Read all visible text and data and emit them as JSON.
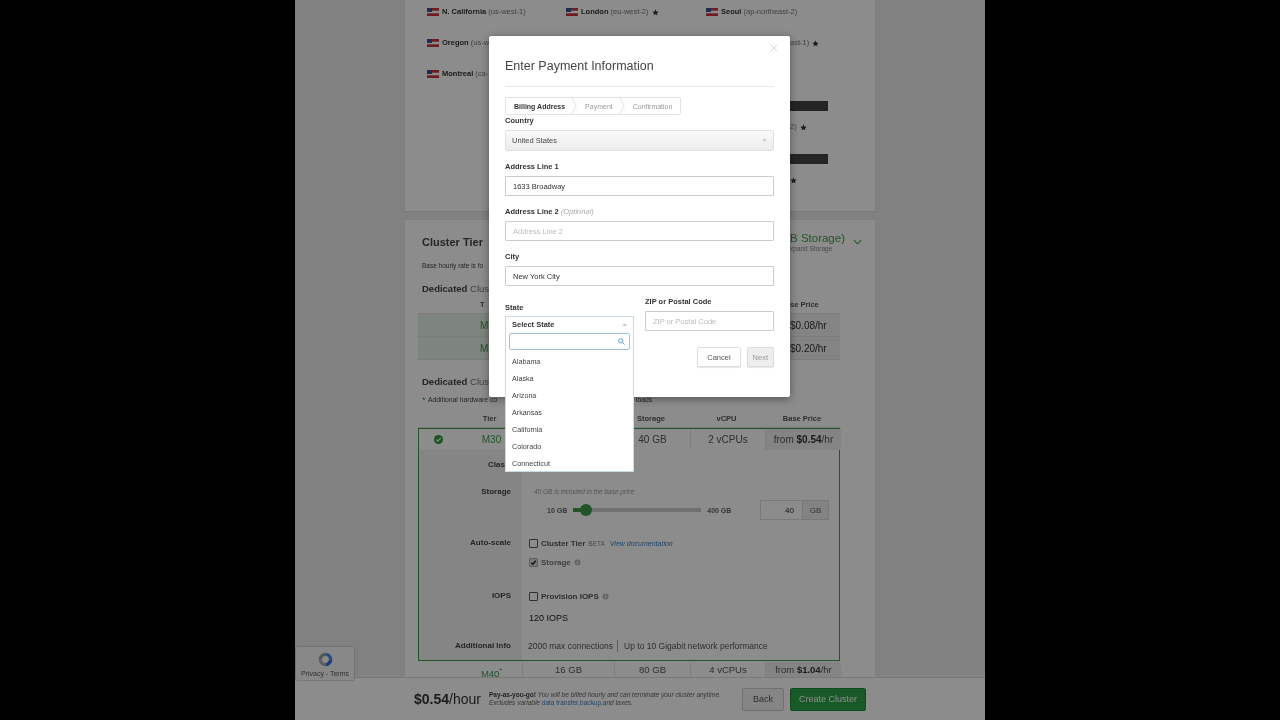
{
  "regions": [
    [
      {
        "kind": "region",
        "name": "N. California",
        "code": "(us-west-1)",
        "star": false
      },
      {
        "kind": "region",
        "name": "Oregon",
        "code": "(us-w",
        "star": false
      },
      {
        "kind": "region",
        "name": "Montreal",
        "code": "(ca-",
        "star": false
      }
    ],
    [
      {
        "kind": "region",
        "name": "London",
        "code": "(eu-west-2)",
        "star": true
      }
    ],
    [
      {
        "kind": "region",
        "name": "Seoul",
        "code": "(ap-northeast-2)",
        "star": false
      },
      {
        "kind": "clipped",
        "code": "ast-1)",
        "star": true
      },
      {
        "kind": "bar"
      },
      {
        "kind": "clipped",
        "code": "2)",
        "star": true
      },
      {
        "kind": "bar"
      },
      {
        "kind": "clipped",
        "star": true
      }
    ]
  ],
  "cluster_tier": {
    "title": "Cluster Tier",
    "summary": "B Storage)",
    "summary_note": "xpand Storage",
    "rate_note": "Base hourly rate is fo",
    "top_group": {
      "heading": "**Dedicated** Clus",
      "header_tier": "T",
      "header_price": "se Price",
      "rows": [
        {
          "tier": "M",
          "price": "$0.08/hr"
        },
        {
          "tier": "M",
          "price": "$0.20/hr"
        }
      ]
    },
    "group": {
      "heading": "**Dedicated** Clus",
      "note_marker": "*",
      "note_start": "Additional hardware co",
      "note_end": "loads",
      "columns": {
        "tier": "Tier",
        "storage": "Storage",
        "vcpu": "vCPU",
        "price": "Base Price"
      },
      "rows": [
        {
          "tier": "M30",
          "selected": true,
          "expanded": true,
          "storage": "40 GB",
          "vcpu": "2 vCPUs",
          "price": "from **$0.54**/hr"
        },
        {
          "tier": "M40",
          "mark": "*",
          "selected": false,
          "expanded": false,
          "ram": "16 GB",
          "storage": "80 GB",
          "vcpu": "4 vCPUs",
          "price": "from **$1.04**/hr"
        }
      ],
      "details": {
        "class_label": "Clas",
        "storage": {
          "label": "Storage",
          "note": "40 GB is included in the base price",
          "min": "10 GB",
          "max": "400 GB",
          "level": 0.1,
          "value": "40",
          "unit": "GB"
        },
        "autoscale": {
          "label": "Auto-scale",
          "options": [
            {
              "label": "Cluster Tier",
              "badge": "BETA",
              "link": "View documentation",
              "checked": false,
              "disabled": false,
              "info": false
            },
            {
              "label": "Storage",
              "checked": true,
              "disabled": true,
              "info": true
            }
          ]
        },
        "iops": {
          "label": "IOPS",
          "option": {
            "label": "Provision IOPS",
            "checked": false,
            "disabled": false,
            "info": true
          },
          "value": "120 IOPS"
        },
        "info": {
          "label": "Additional Info",
          "items": [
            "2000 max connections",
            "Up to 10 Gigabit network performance"
          ]
        }
      }
    }
  },
  "footer": {
    "price": "$0.54",
    "unit": "/hour",
    "note": {
      "lead": "Pay-as-you-go!",
      "text": "You will be billed hourly and can terminate your cluster anytime. Excludes variable",
      "links": [
        {
          "text": "data transfer",
          "after": ","
        },
        {
          "text": "backup",
          "after": ","
        }
      ],
      "end": "and taxes."
    },
    "buttons": [
      {
        "label": "Back",
        "kind": "secondary"
      },
      {
        "label": "Create Cluster",
        "kind": "primary"
      }
    ]
  },
  "recaptcha": "Privacy - Terms",
  "modal": {
    "title": "Enter Payment Information",
    "steps": [
      {
        "label": "Billing Address",
        "selected": true
      },
      {
        "label": "Payment",
        "selected": false
      },
      {
        "label": "Confirmation",
        "selected": false
      }
    ],
    "fields": [
      {
        "kind": "select",
        "label": "Country",
        "value": "United States"
      },
      {
        "kind": "text",
        "label": "Address Line 1",
        "value": "1633 Broadway"
      },
      {
        "kind": "text",
        "label": "Address Line 2",
        "hint": "(Optional)",
        "placeholder": "Address Line 2"
      },
      {
        "kind": "text",
        "label": "City",
        "value": "New York City"
      }
    ],
    "state": {
      "label": "State",
      "placeholder": "Select State",
      "expanded": true,
      "options": [
        "Alabama",
        "Alaska",
        "Arizona",
        "Arkansas",
        "California",
        "Colorado",
        "Connecticut"
      ]
    },
    "zip": {
      "label": "ZIP or Postal Code",
      "placeholder": "ZIP or Postal Code"
    },
    "buttons": [
      {
        "label": "Cancel",
        "disabled": false
      },
      {
        "label": "Next",
        "disabled": true
      }
    ]
  }
}
